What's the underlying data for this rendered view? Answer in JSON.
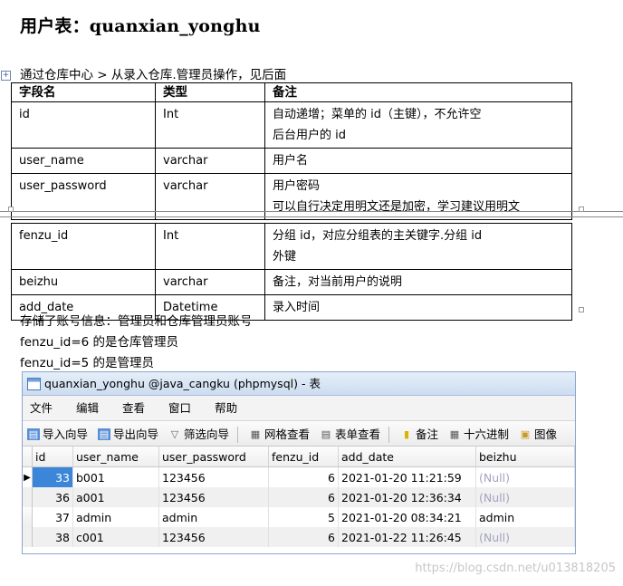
{
  "doc": {
    "title": "用户表：quanxian_yonghu",
    "intro": "通过仓库中心  > 从录入仓库.管理员操作，见后面",
    "headers": [
      "字段名",
      "类型",
      "备注"
    ],
    "rows_top": [
      {
        "field": "id",
        "type": "Int",
        "note1": "自动递增；菜单的 id（主键），不允许空",
        "note2": "后台用户的 id"
      },
      {
        "field": "user_name",
        "type": "varchar",
        "note1": "用户名",
        "note2": ""
      },
      {
        "field": "user_password",
        "type": "varchar",
        "note1": "用户密码",
        "note2": "可以自行决定用明文还是加密，学习建议用明文"
      }
    ],
    "rows_bottom": [
      {
        "field": "fenzu_id",
        "type": "Int",
        "note1": "分组 id，对应分组表的主关键字.分组 id",
        "note2": "外键"
      },
      {
        "field": "beizhu",
        "type": "varchar",
        "note1": "备注，对当前用户的说明",
        "note2": ""
      },
      {
        "field": "add_date",
        "type": "Datetime",
        "note1": "录入时间",
        "note2": ""
      }
    ],
    "notes": [
      "存储了账号信息：管理员和仓库管理员账号",
      "fenzu_id=6 的是仓库管理员",
      "fenzu_id=5 的是管理员"
    ]
  },
  "db_window": {
    "title": "quanxian_yonghu @java_cangku (phpmysql) - 表",
    "menu": [
      "文件",
      "编辑",
      "查看",
      "窗口",
      "帮助"
    ],
    "toolbar": [
      {
        "label": "导入向导",
        "icon": "import-icon"
      },
      {
        "label": "导出向导",
        "icon": "export-icon"
      },
      {
        "label": "筛选向导",
        "icon": "filter-icon"
      },
      {
        "label": "网格查看",
        "icon": "grid-icon"
      },
      {
        "label": "表单查看",
        "icon": "form-icon"
      },
      {
        "label": "备注",
        "icon": "note-icon"
      },
      {
        "label": "十六进制",
        "icon": "hex-icon"
      },
      {
        "label": "图像",
        "icon": "image-icon"
      }
    ],
    "columns": [
      "id",
      "user_name",
      "user_password",
      "fenzu_id",
      "add_date",
      "beizhu"
    ],
    "rows": [
      {
        "id": "33",
        "user_name": "b001",
        "user_password": "123456",
        "fenzu_id": "6",
        "add_date": "2021-01-20 11:21:59",
        "beizhu": "(Null)"
      },
      {
        "id": "36",
        "user_name": "a001",
        "user_password": "123456",
        "fenzu_id": "6",
        "add_date": "2021-01-20 12:36:34",
        "beizhu": "(Null)"
      },
      {
        "id": "37",
        "user_name": "admin",
        "user_password": "admin",
        "fenzu_id": "5",
        "add_date": "2021-01-20 08:34:21",
        "beizhu": "admin"
      },
      {
        "id": "38",
        "user_name": "c001",
        "user_password": "123456",
        "fenzu_id": "6",
        "add_date": "2021-01-22 11:26:45",
        "beizhu": "(Null)"
      }
    ]
  },
  "watermark": "https://blog.csdn.net/u013818205"
}
